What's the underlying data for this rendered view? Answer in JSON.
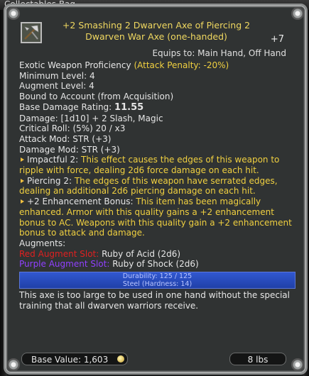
{
  "background_window": {
    "title": "Collectables Bag"
  },
  "item": {
    "name": "+2 Smashing 2 Dwarven Axe of Piercing 2 Dwarven War Axe (one-handed)",
    "plus_level": "+7",
    "icon": "dwarven-axe-icon",
    "equips_to": "Equips to: Main Hand, Off Hand"
  },
  "stats": {
    "proficiency": "Exotic Weapon Proficiency",
    "attack_penalty": "(Attack Penalty: -20%)",
    "minimum_level": "Minimum Level: 4",
    "augment_level": "Augment Level: 4",
    "binding": "Bound to Account (from Acquisition)",
    "base_damage_label": "Base Damage Rating:",
    "base_damage_value": "11.55",
    "damage": "Damage: [1d10] + 2 Slash, Magic",
    "critical_roll": "Critical Roll: (5%) 20 / x3",
    "attack_mod": "Attack Mod: STR (+3)",
    "damage_mod": "Damage Mod: STR (+3)"
  },
  "effects": [
    {
      "name": "Impactful 2:",
      "text": "This effect causes the edges of this weapon to ripple with force, dealing 2d6 force damage on each hit."
    },
    {
      "name": "Piercing 2:",
      "text": "The edges of this weapon have serrated edges, dealing an additional 2d6 piercing damage on each hit."
    },
    {
      "name": "+2 Enhancement Bonus:",
      "text": "This item has been magically enhanced. Armor with this quality gains a +2 enhancement bonus to AC. Weapons with this quality gain a +2 enhancement bonus to attack and damage."
    }
  ],
  "augments": {
    "label": "Augments:",
    "slots": [
      {
        "slot": "Red Augment Slot:",
        "value": "Ruby of Acid (2d6)",
        "color": "#e02020"
      },
      {
        "slot": "Purple Augment Slot:",
        "value": "Ruby of Shock (2d6)",
        "color": "#9040ff"
      }
    ]
  },
  "durability": {
    "text": "Durability: 125 / 125",
    "material": "Steel (Hardness: 14)",
    "fraction": 1.0
  },
  "description": "This axe is too large to be used in one hand without the special training that all dwarven warriors receive.",
  "footer": {
    "base_value": "Base Value: 1,603",
    "weight": "8 lbs"
  },
  "colors": {
    "item_name": "#f0d860",
    "highlight": "#f0d040",
    "panel_bg": "#303333",
    "durability_bar": "#2a48b8"
  }
}
